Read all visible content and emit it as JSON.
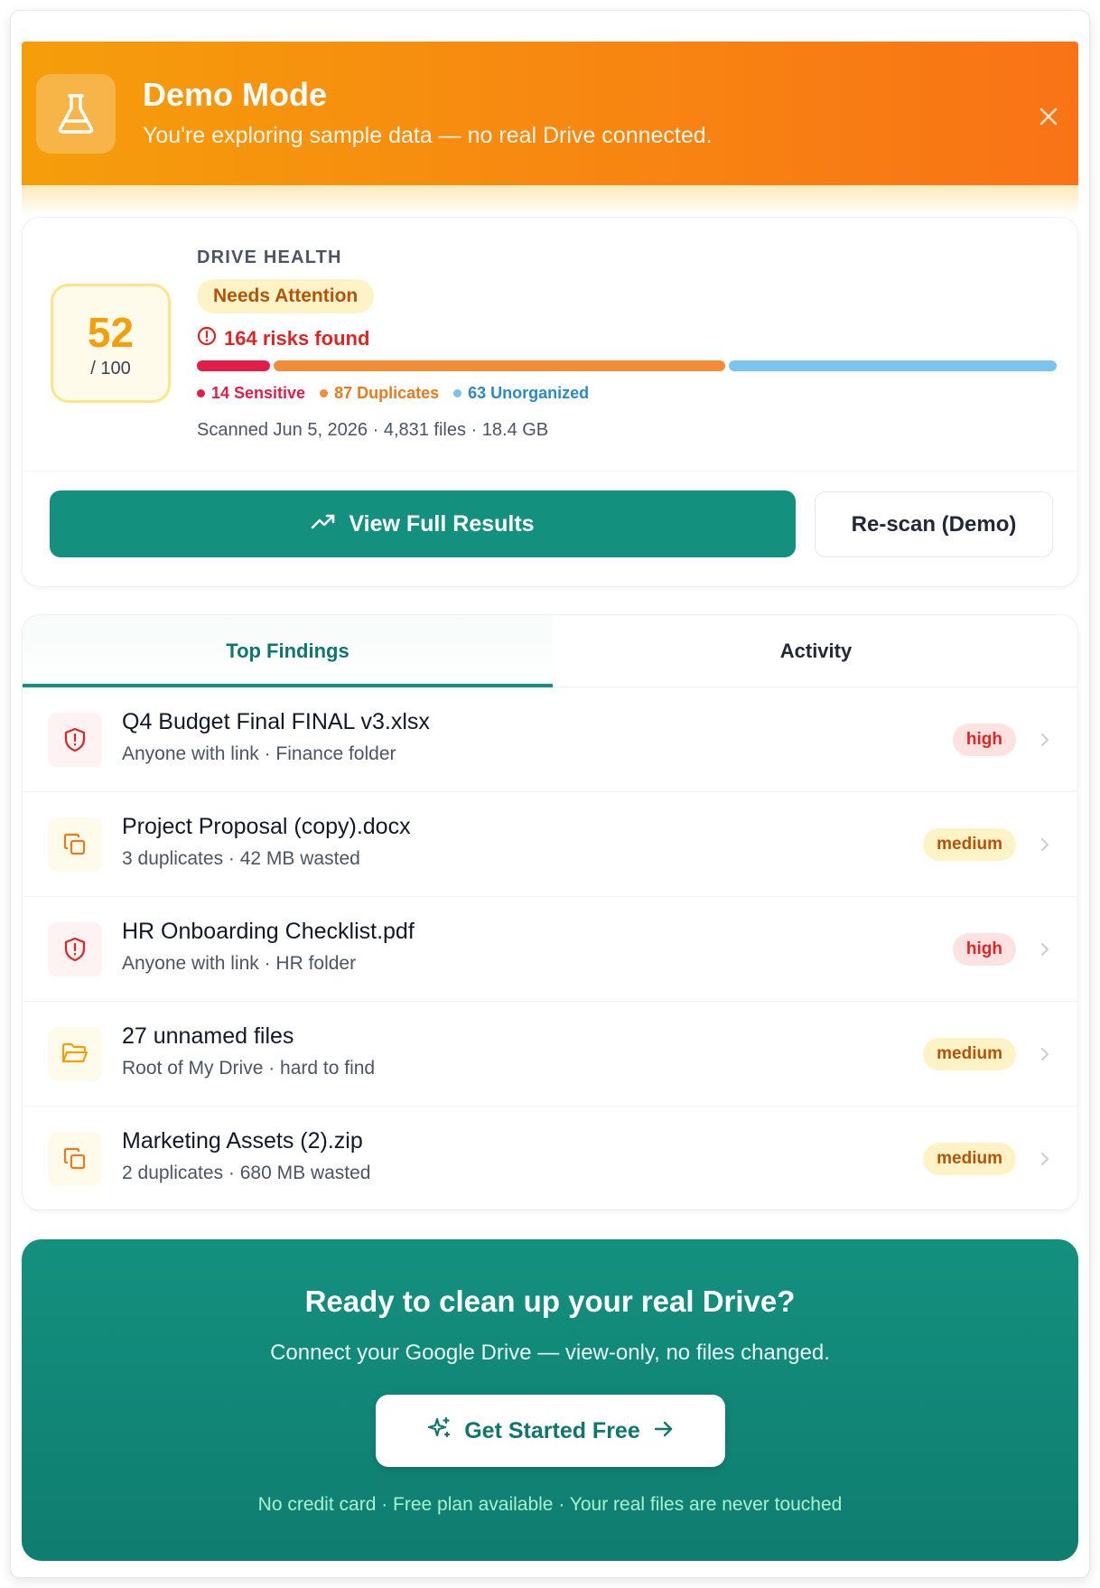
{
  "banner": {
    "icon": "flask-icon",
    "title": "Demo Mode",
    "subtitle": "You're exploring sample data — no real Drive connected.",
    "close_icon": "close-icon",
    "colors": {
      "start": "#f59e0b",
      "end": "#f97316"
    }
  },
  "health": {
    "score": "52",
    "score_max": "/ 100",
    "label": "DRIVE HEALTH",
    "status_badge": "Needs Attention",
    "risks_text": "164 risks found",
    "breakdown": [
      {
        "label": "14 Sensitive",
        "count": 14,
        "color": "#e11d48"
      },
      {
        "label": "87 Duplicates",
        "count": 87,
        "color": "#f28c38"
      },
      {
        "label": "63 Unorganized",
        "count": 63,
        "color": "#7cc4f0"
      }
    ],
    "scanned_text": "Scanned Jun 5, 2026 · 4,831 files · 18.4 GB"
  },
  "actions": {
    "view_results": "View Full Results",
    "rescan": "Re-scan (Demo)"
  },
  "tabs": [
    {
      "label": "Top Findings",
      "active": true
    },
    {
      "label": "Activity",
      "active": false
    }
  ],
  "findings": [
    {
      "title": "Q4 Budget Final FINAL v3.xlsx",
      "subtitle": "Anyone with link · Finance folder",
      "severity": "high",
      "icon": "shield-alert-icon"
    },
    {
      "title": "Project Proposal (copy).docx",
      "subtitle": "3 duplicates · 42 MB wasted",
      "severity": "medium",
      "icon": "copy-icon"
    },
    {
      "title": "HR Onboarding Checklist.pdf",
      "subtitle": "Anyone with link · HR folder",
      "severity": "high",
      "icon": "shield-alert-icon"
    },
    {
      "title": "27 unnamed files",
      "subtitle": "Root of My Drive · hard to find",
      "severity": "medium",
      "icon": "folder-open-icon"
    },
    {
      "title": "Marketing Assets (2).zip",
      "subtitle": "2 duplicates · 680 MB wasted",
      "severity": "medium",
      "icon": "copy-icon"
    }
  ],
  "cta": {
    "title": "Ready to clean up your real Drive?",
    "subtitle": "Connect your Google Drive — view-only, no files changed.",
    "button": "Get Started Free",
    "footnote": "No credit card · Free plan available · Your real files are never touched",
    "color": "#14907f"
  }
}
